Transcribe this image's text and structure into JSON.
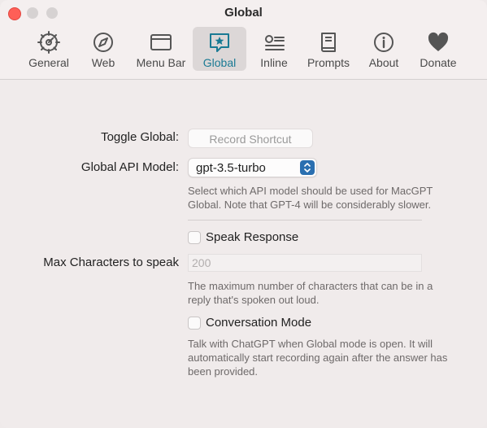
{
  "window": {
    "title": "Global"
  },
  "tabs": [
    {
      "label": "General",
      "icon": "gear-icon"
    },
    {
      "label": "Web",
      "icon": "compass-icon"
    },
    {
      "label": "Menu Bar",
      "icon": "menubar-window-icon"
    },
    {
      "label": "Global",
      "icon": "star-bubble-icon",
      "selected": true
    },
    {
      "label": "Inline",
      "icon": "list-icon"
    },
    {
      "label": "Prompts",
      "icon": "book-icon"
    },
    {
      "label": "About",
      "icon": "info-icon"
    },
    {
      "label": "Donate",
      "icon": "heart-icon"
    }
  ],
  "settings": {
    "toggle_global_label": "Toggle Global:",
    "record_shortcut_label": "Record Shortcut",
    "api_model_label": "Global API Model:",
    "api_model_value": "gpt-3.5-turbo",
    "api_model_help": "Select which API model should be used for MacGPT Global. Note that GPT-4 will be considerably slower.",
    "speak_response_label": "Speak Response",
    "speak_response_checked": false,
    "max_chars_label": "Max Characters to speak",
    "max_chars_placeholder": "200",
    "max_chars_help": "The maximum number of characters that can be in a reply that's spoken out loud.",
    "conversation_mode_label": "Conversation Mode",
    "conversation_mode_checked": false,
    "conversation_mode_help": "Talk with ChatGPT when Global mode is open. It will automatically start recording again after the answer has been provided."
  },
  "colors": {
    "accent": "#1a7a94",
    "close_button": "#fe5f57",
    "select_stepper": "#2a6fb0"
  }
}
